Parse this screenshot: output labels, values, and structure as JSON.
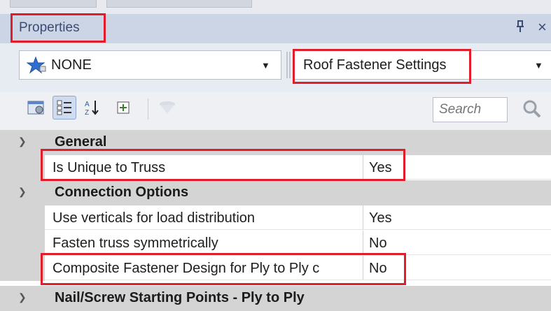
{
  "panel": {
    "title": "Properties",
    "pin_label": "ᴨ",
    "close_label": "×"
  },
  "selectors": {
    "left_value": "NONE",
    "right_value": "Roof Fastener Settings"
  },
  "toolbar": {
    "search_placeholder": "Search"
  },
  "grid": {
    "categories": [
      {
        "label": "General",
        "rows": [
          {
            "name": "Is Unique to Truss",
            "value": "Yes"
          }
        ]
      },
      {
        "label": "Connection Options",
        "rows": [
          {
            "name": "Use verticals for load distribution",
            "value": "Yes"
          },
          {
            "name": "Fasten truss symmetrically",
            "value": "No"
          },
          {
            "name": "Composite Fastener Design for Ply to Ply c",
            "value": "No"
          }
        ]
      },
      {
        "label": "Nail/Screw Starting Points - Ply to Ply",
        "rows": []
      }
    ]
  },
  "colors": {
    "highlight": "#e21d2b",
    "title_bar": "#ccd5e6",
    "category_bg": "#d4d4d4"
  }
}
